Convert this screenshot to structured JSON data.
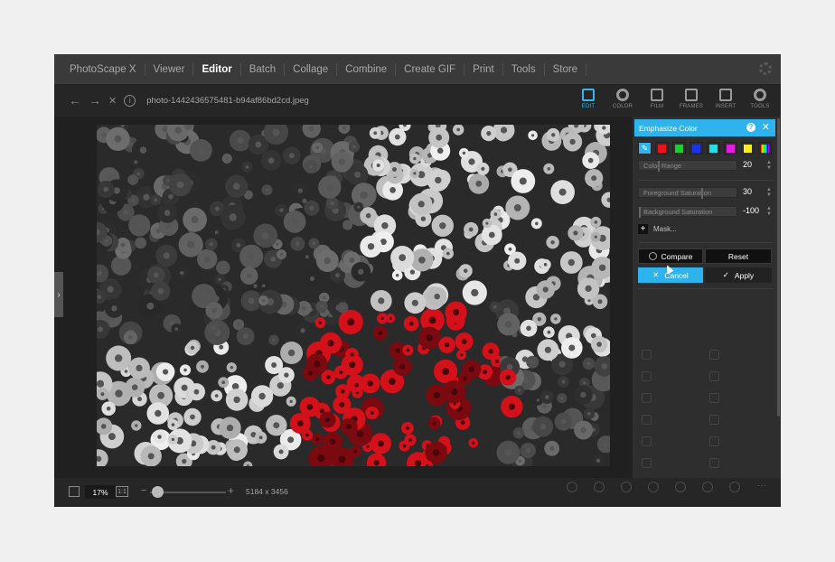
{
  "menu": {
    "items": [
      {
        "label": "PhotoScape X"
      },
      {
        "label": "Viewer"
      },
      {
        "label": "Editor"
      },
      {
        "label": "Batch"
      },
      {
        "label": "Collage"
      },
      {
        "label": "Combine"
      },
      {
        "label": "Create GIF"
      },
      {
        "label": "Print"
      },
      {
        "label": "Tools"
      },
      {
        "label": "Store"
      }
    ],
    "active": "Editor"
  },
  "toolbar": {
    "back": "←",
    "forward": "→",
    "close": "✕",
    "info": "i",
    "filename": "photo-1442436575481-b94af86bd2cd.jpeg",
    "tabs": [
      {
        "label": "EDIT"
      },
      {
        "label": "COLOR"
      },
      {
        "label": "FILM"
      },
      {
        "label": "FRAMES"
      },
      {
        "label": "INSERT"
      },
      {
        "label": "TOOLS"
      }
    ]
  },
  "panel": {
    "title": "Emphasize Color",
    "help": "?",
    "close": "✕",
    "eyedropper": "✎",
    "swatch_colors": [
      "#e8141b",
      "#19d02a",
      "#1c33e6",
      "#1de0e6",
      "#e21ee0",
      "#f5f01c",
      "#888888"
    ],
    "color_range": {
      "label": "Color Range",
      "value": "20",
      "level": 0.2
    },
    "foreground_saturation": {
      "label": "Foreground Saturation",
      "value": "30",
      "level": 0.65
    },
    "background_saturation": {
      "label": "Background Saturation",
      "value": "-100",
      "level": 0.0
    },
    "mask_label": "Mask...",
    "compare_label": "Compare",
    "reset_label": "Reset",
    "cancel_label": "Cancel",
    "apply_label": "Apply"
  },
  "bottom": {
    "zoom": "17%",
    "one_to_one": "1:1",
    "minus": "−",
    "plus": "+",
    "zoom_level": 0.17,
    "dimensions": "5184 x 3456"
  },
  "colors": {
    "accent": "#2eb3ec",
    "menubar": "#3a3a3a",
    "panel": "#2e2e2e",
    "emphasis_red": "#d4101a"
  }
}
